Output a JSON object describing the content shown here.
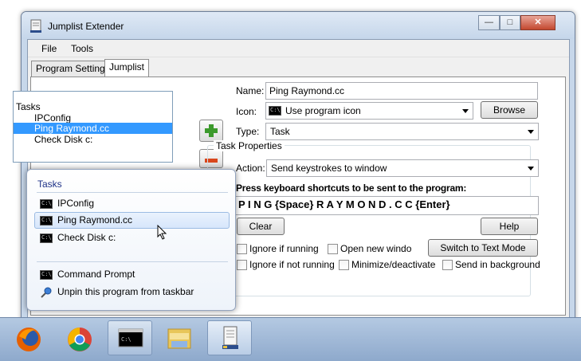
{
  "window": {
    "title": "Jumplist Extender",
    "controls": {
      "minimize": "—",
      "maximize": "□",
      "close": "✕"
    }
  },
  "menu": {
    "file": "File",
    "tools": "Tools"
  },
  "tabs": {
    "program_settings": "Program Settings",
    "jumplist": "Jumplist"
  },
  "list": {
    "header": "Tasks",
    "items": [
      "IPConfig",
      "Ping Raymond.cc",
      "Check Disk c:"
    ],
    "selected": "Ping Raymond.cc"
  },
  "form": {
    "name_label": "Name:",
    "name_value": "Ping Raymond.cc",
    "icon_label": "Icon:",
    "icon_value": "Use program icon",
    "browse": "Browse",
    "type_label": "Type:",
    "type_value": "Task",
    "group_title": "Task Properties",
    "action_label": "Action:",
    "action_value": "Send keystrokes to window",
    "shortcut_prompt": "Press keyboard shortcuts to be sent to the program:",
    "shortcut_value": "P I N G {Space} R A Y M O N D . C C {Enter}",
    "clear": "Clear",
    "help": "Help",
    "ignore_running": "Ignore if running",
    "open_new": "Open  new windo",
    "switch_text": "Switch to Text Mode",
    "ignore_not_running": "Ignore if not running",
    "minimize": "Minimize/deactivate",
    "send_background": "Send in background"
  },
  "popup": {
    "tasks_header": "Tasks",
    "items": [
      "IPConfig",
      "Ping Raymond.cc",
      "Check Disk c:"
    ],
    "command_prompt": "Command Prompt",
    "unpin": "Unpin this program from taskbar"
  },
  "taskbar": {
    "icons": [
      "firefox-icon",
      "chrome-icon",
      "cmd-icon",
      "explorer-icon",
      "jumplist-extender-icon"
    ]
  }
}
